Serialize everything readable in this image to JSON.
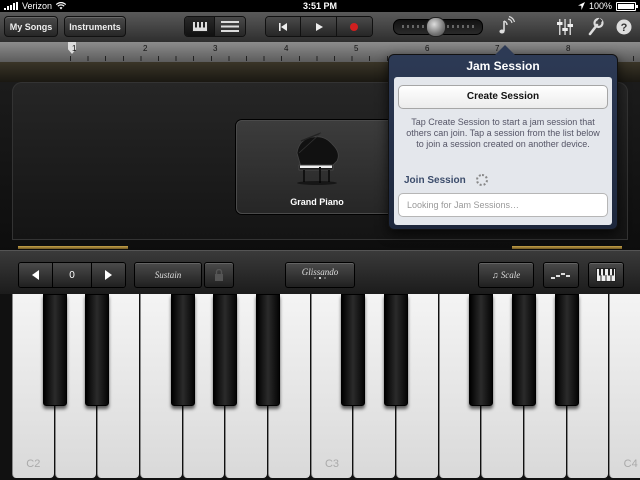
{
  "status_bar": {
    "carrier": "Verizon",
    "time": "3:51 PM",
    "battery": "100%"
  },
  "toolbar": {
    "my_songs": "My Songs",
    "instruments": "Instruments",
    "view_options": [
      "keyboard-view-icon",
      "tracks-view-icon"
    ],
    "transport": [
      "go-to-beginning-icon",
      "play-icon",
      "record-icon"
    ],
    "master_volume_level": 0.45,
    "record_color": "#d01f1f"
  },
  "ruler": {
    "marks": [
      "1",
      "2",
      "3",
      "4",
      "5",
      "6",
      "7",
      "8"
    ]
  },
  "instrument": {
    "name": "Grand Piano"
  },
  "controls": {
    "octave_value": "0",
    "sustain": "Sustain",
    "glissando": "Glissando",
    "scale": "Scale"
  },
  "keyboard": {
    "labels": [
      "C2",
      "C3",
      "C4"
    ]
  },
  "jam_session": {
    "title": "Jam Session",
    "create_button": "Create Session",
    "description": "Tap Create Session to start a jam session that others can join. Tap a session from the list below to join a session created on another device.",
    "join_label": "Join Session",
    "search_placeholder": "Looking for Jam Sessions…"
  },
  "colors": {
    "accent_gold": "#c8a44a",
    "popover_header": "#2d3a55"
  }
}
